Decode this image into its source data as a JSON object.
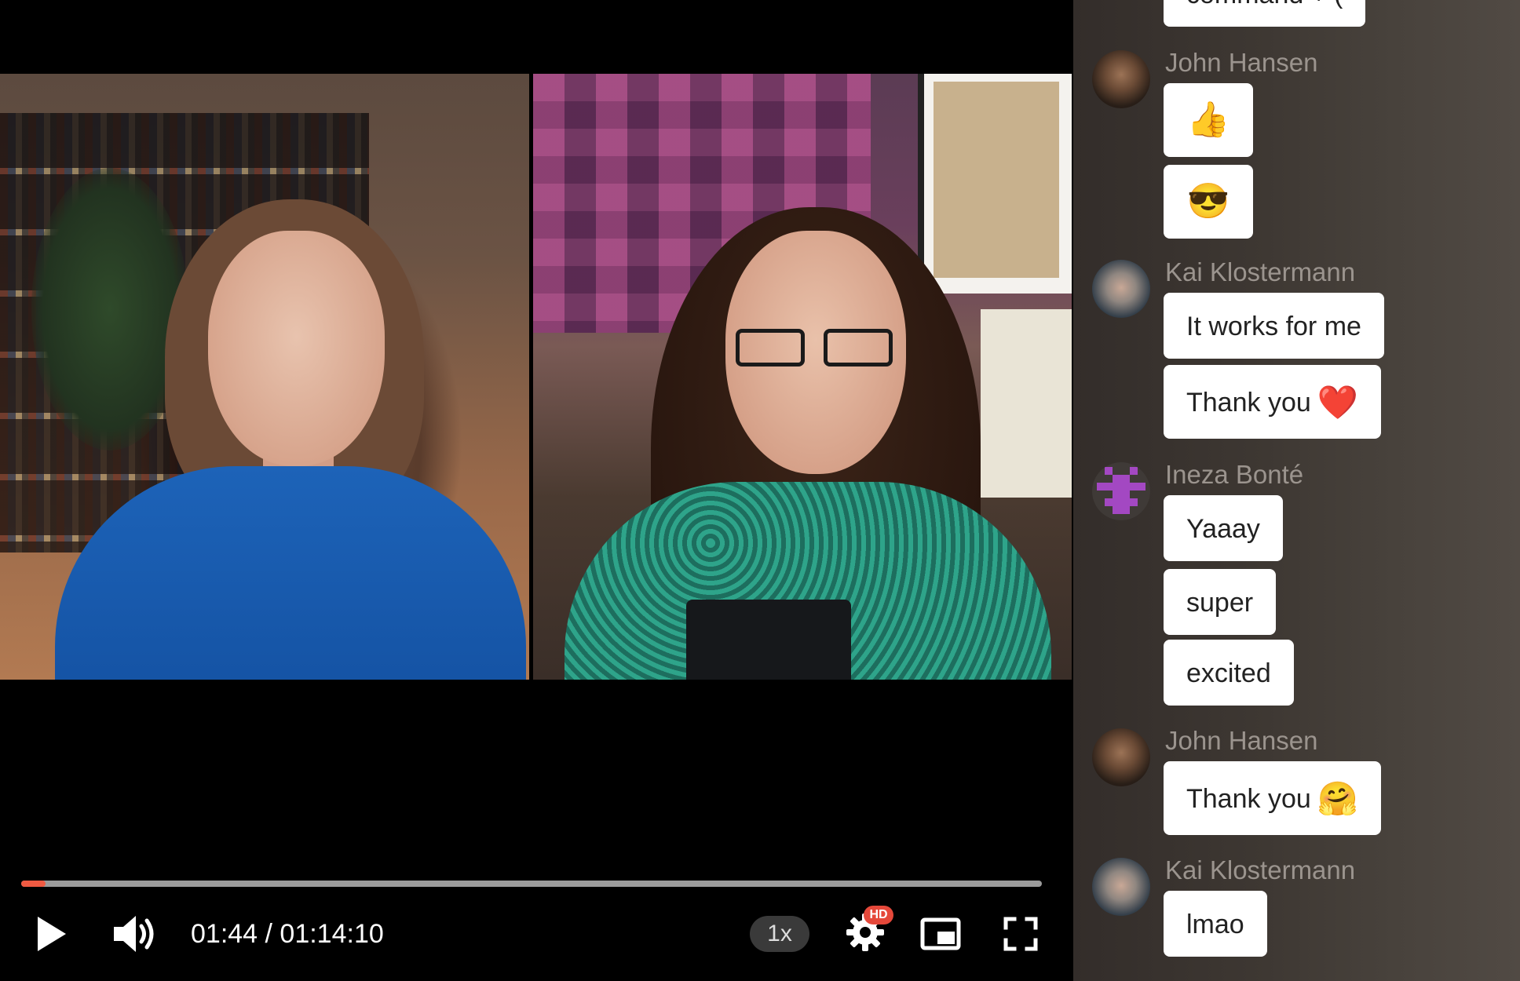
{
  "player": {
    "current_time": "01:44",
    "total_time": "01:14:10",
    "time_display": "01:44 / 01:14:10",
    "progress_fraction": 0.024,
    "speed_label": "1x",
    "quality_badge": "HD",
    "accent_color": "#ef5a42",
    "icons": [
      "play-icon",
      "volume-icon",
      "gear-icon",
      "picture-in-picture-icon",
      "fullscreen-icon"
    ]
  },
  "chat": {
    "top_partial_message": "command + (",
    "groups": [
      {
        "author": "John Hansen",
        "avatar": "john",
        "messages": [
          "👍",
          "😎"
        ]
      },
      {
        "author": "Kai Klostermann",
        "avatar": "kai",
        "messages": [
          "It works for me",
          "Thank you"
        ],
        "emojis": [
          "",
          "❤️"
        ]
      },
      {
        "author": "Ineza Bonté",
        "avatar": "ineza",
        "messages": [
          "Yaaay",
          "super",
          "excited"
        ]
      },
      {
        "author": "John Hansen",
        "avatar": "john",
        "messages": [
          "Thank you"
        ],
        "emojis": [
          "🤗"
        ]
      },
      {
        "author": "Kai Klostermann",
        "avatar": "kai",
        "messages": [
          "lmao"
        ]
      }
    ]
  }
}
